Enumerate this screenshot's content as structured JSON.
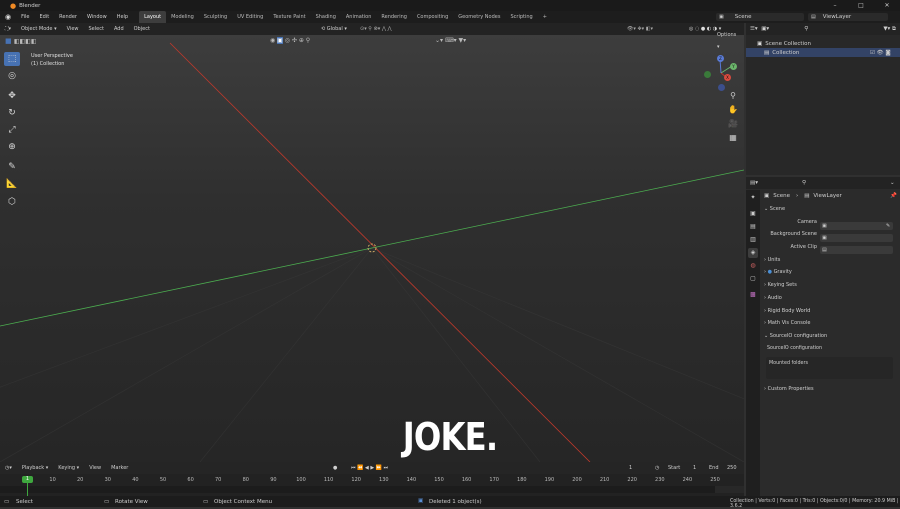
{
  "window": {
    "title": "Blender"
  },
  "menu": [
    "File",
    "Edit",
    "Render",
    "Window",
    "Help"
  ],
  "workspaces": [
    "Layout",
    "Modeling",
    "Sculpting",
    "UV Editing",
    "Texture Paint",
    "Shading",
    "Animation",
    "Rendering",
    "Compositing",
    "Geometry Nodes",
    "Scripting"
  ],
  "active_workspace": "Layout",
  "scene_field": "Scene",
  "viewlayer_field": "ViewLayer",
  "viewport": {
    "mode": "Object Mode",
    "menu": [
      "View",
      "Select",
      "Add",
      "Object"
    ],
    "transform": "Global",
    "options": "Options",
    "info_line1": "User Perspective",
    "info_line2": "(1) Collection",
    "overlay_text": "JOKE."
  },
  "outliner": {
    "root": "Scene Collection",
    "child": "Collection"
  },
  "properties": {
    "breadcrumb_scene": "Scene",
    "breadcrumb_viewlayer": "ViewLayer",
    "section": "Scene",
    "fields": [
      {
        "label": "Camera"
      },
      {
        "label": "Background Scene"
      },
      {
        "label": "Active Clip"
      }
    ],
    "panels": [
      "Units",
      "Gravity",
      "Keying Sets",
      "Audio",
      "Rigid Body World",
      "Math Vis Console"
    ],
    "source_panel": "SourceIO configuration",
    "source_sub": "SourceIO configuration",
    "mounted": "Mounted folders",
    "custom": "Custom Properties"
  },
  "timeline": {
    "menu": [
      "Playback",
      "Keying",
      "View",
      "Marker"
    ],
    "current_frame": "1",
    "start_label": "Start",
    "start": "1",
    "end_label": "End",
    "end": "250",
    "playhead": "1",
    "ticks": [
      "10",
      "20",
      "30",
      "40",
      "50",
      "60",
      "70",
      "80",
      "90",
      "100",
      "110",
      "120",
      "130",
      "140",
      "150",
      "160",
      "170",
      "180",
      "190",
      "200",
      "210",
      "220",
      "230",
      "240",
      "250"
    ]
  },
  "status": {
    "select": "Select",
    "rotate": "Rotate View",
    "context": "Object Context Menu",
    "message": "Deleted 1 object(s)",
    "stats": "Collection | Verts:0 | Faces:0 | Tris:0 | Objects:0/0 | Memory: 20.9 MiB | 3.6.2"
  },
  "colors": {
    "accent": "#4772b3",
    "x_axis": "#c0392b",
    "y_axis": "#4caf50",
    "playhead": "#3fa83f"
  }
}
